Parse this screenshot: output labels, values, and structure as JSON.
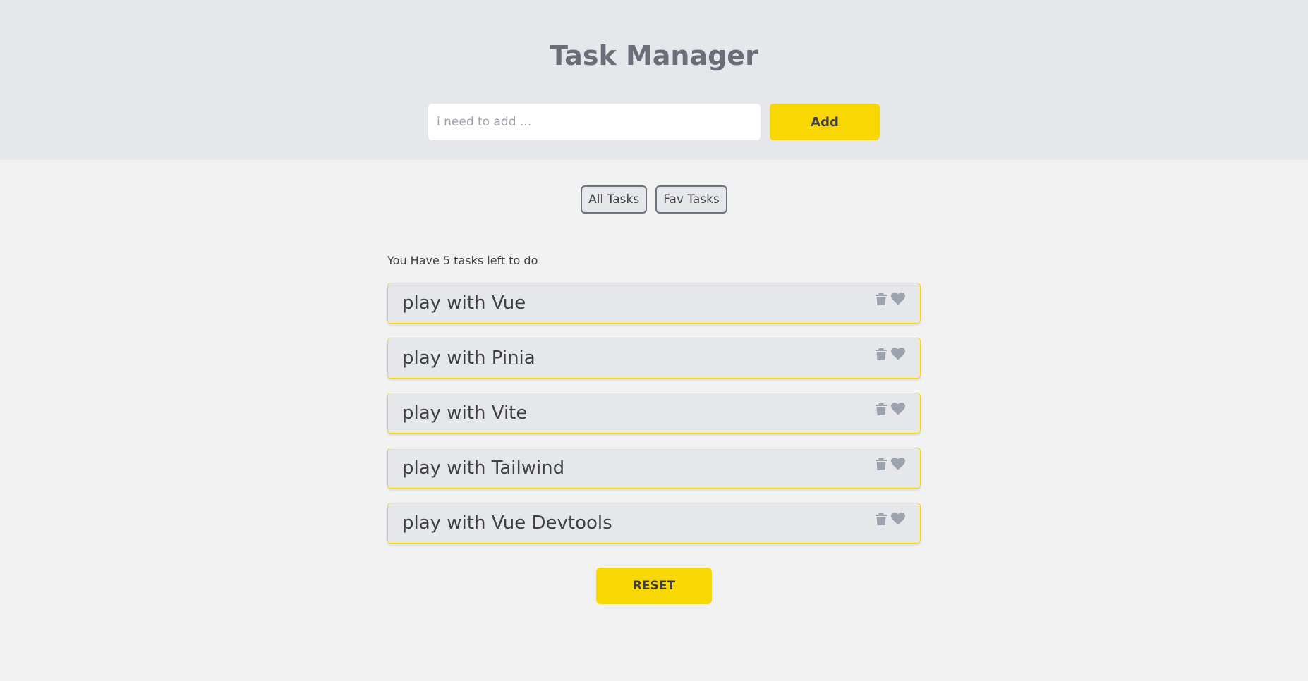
{
  "header": {
    "title": "Task Manager",
    "input_placeholder": "i need to add ...",
    "input_value": "",
    "add_label": "Add"
  },
  "filters": {
    "all_label": "All Tasks",
    "fav_label": "Fav Tasks"
  },
  "tasks_summary": "You Have 5 tasks left to do",
  "tasks": [
    {
      "title": "play with Vue",
      "icons": [
        "trash-icon",
        "heart-icon"
      ]
    },
    {
      "title": "play with Pinia",
      "icons": [
        "trash-icon",
        "heart-icon"
      ]
    },
    {
      "title": "play with Vite",
      "icons": [
        "trash-icon",
        "heart-icon"
      ]
    },
    {
      "title": "play with Tailwind",
      "icons": [
        "trash-icon",
        "heart-icon"
      ]
    },
    {
      "title": "play with Vue Devtools",
      "icons": [
        "trash-icon",
        "heart-icon"
      ]
    }
  ],
  "reset_label": "RESET",
  "colors": {
    "accent": "#f9d703",
    "header_bg": "#e5e7eb",
    "page_bg": "#f2f2f2",
    "icon": "#9ca3af"
  }
}
